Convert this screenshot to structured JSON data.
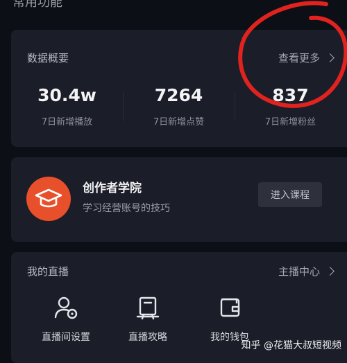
{
  "header": {
    "cut_title": "常用功能"
  },
  "data_overview": {
    "title": "数据概要",
    "more_label": "查看更多",
    "stats": [
      {
        "value": "30.4w",
        "label": "7日新增播放"
      },
      {
        "value": "7264",
        "label": "7日新增点赞"
      },
      {
        "value": "837",
        "label": "7日新增粉丝"
      }
    ]
  },
  "academy": {
    "icon": "graduation-cap-icon",
    "title": "创作者学院",
    "subtitle": "学习经营账号的技巧",
    "button_label": "进入课程",
    "accent_color": "#e8502b"
  },
  "live": {
    "title": "我的直播",
    "more_label": "主播中心",
    "items": [
      {
        "icon": "live-settings-icon",
        "label": "直播间设置"
      },
      {
        "icon": "live-guide-icon",
        "label": "直播攻略"
      },
      {
        "icon": "wallet-icon",
        "label": "我的钱包"
      }
    ]
  },
  "annotation": {
    "color": "#e0231f"
  },
  "watermark": "知乎 @花猫大叔短视频"
}
